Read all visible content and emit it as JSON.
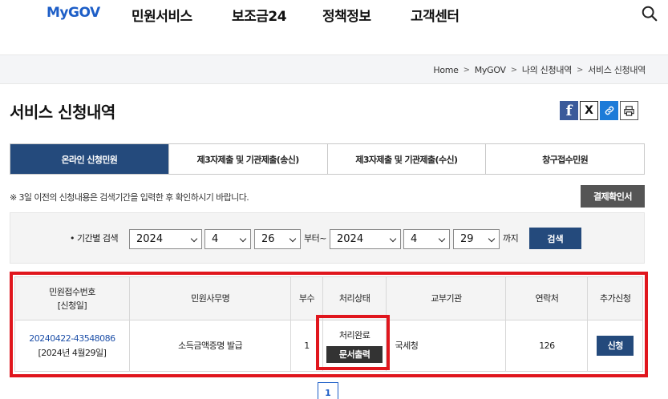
{
  "nav": {
    "logo": "MyGOV",
    "items": [
      "민원서비스",
      "보조금24",
      "정책정보",
      "고객센터"
    ]
  },
  "breadcrumb": [
    "Home",
    "MyGOV",
    "나의 신청내역",
    "서비스 신청내역"
  ],
  "page_title": "서비스 신청내역",
  "share": {
    "facebook": "f",
    "x": "X",
    "link": "🔗",
    "print": "🖶"
  },
  "tabs": [
    {
      "label": "온라인 신청민원",
      "active": true
    },
    {
      "label": "제3자제출 및 기관제출(송신)",
      "active": false
    },
    {
      "label": "제3자제출 및 기관제출(수신)",
      "active": false
    },
    {
      "label": "창구접수민원",
      "active": false
    }
  ],
  "notice": "※ 3일 이전의 신청내용은 검색기간을 입력한 후 확인하시기 바랍니다.",
  "confirm_button": "결제확인서",
  "search": {
    "label": "• 기간별 검색",
    "from_year": "2024",
    "from_month": "4",
    "from_day": "26",
    "from_suffix": "부터~",
    "to_year": "2024",
    "to_month": "4",
    "to_day": "29",
    "to_suffix": "까지",
    "button": "검색"
  },
  "table": {
    "headers": [
      "민원접수번호",
      "[신청일]",
      "민원사무명",
      "부수",
      "처리상태",
      "교부기관",
      "연락처",
      "추가신청"
    ],
    "rows": [
      {
        "receipt_no": "20240422-43548086",
        "date": "[2024년 4월29일]",
        "service": "소득금액증명 발급",
        "copies": "1",
        "status": "처리완료",
        "status_button": "문서출력",
        "agency": "국세청",
        "contact": "126",
        "apply_button": "신청"
      }
    ]
  },
  "pagination": {
    "current": "1"
  },
  "colors": {
    "accent": "#244a7c",
    "brand_blue": "#1d5ec7",
    "highlight": "#e0161d"
  }
}
